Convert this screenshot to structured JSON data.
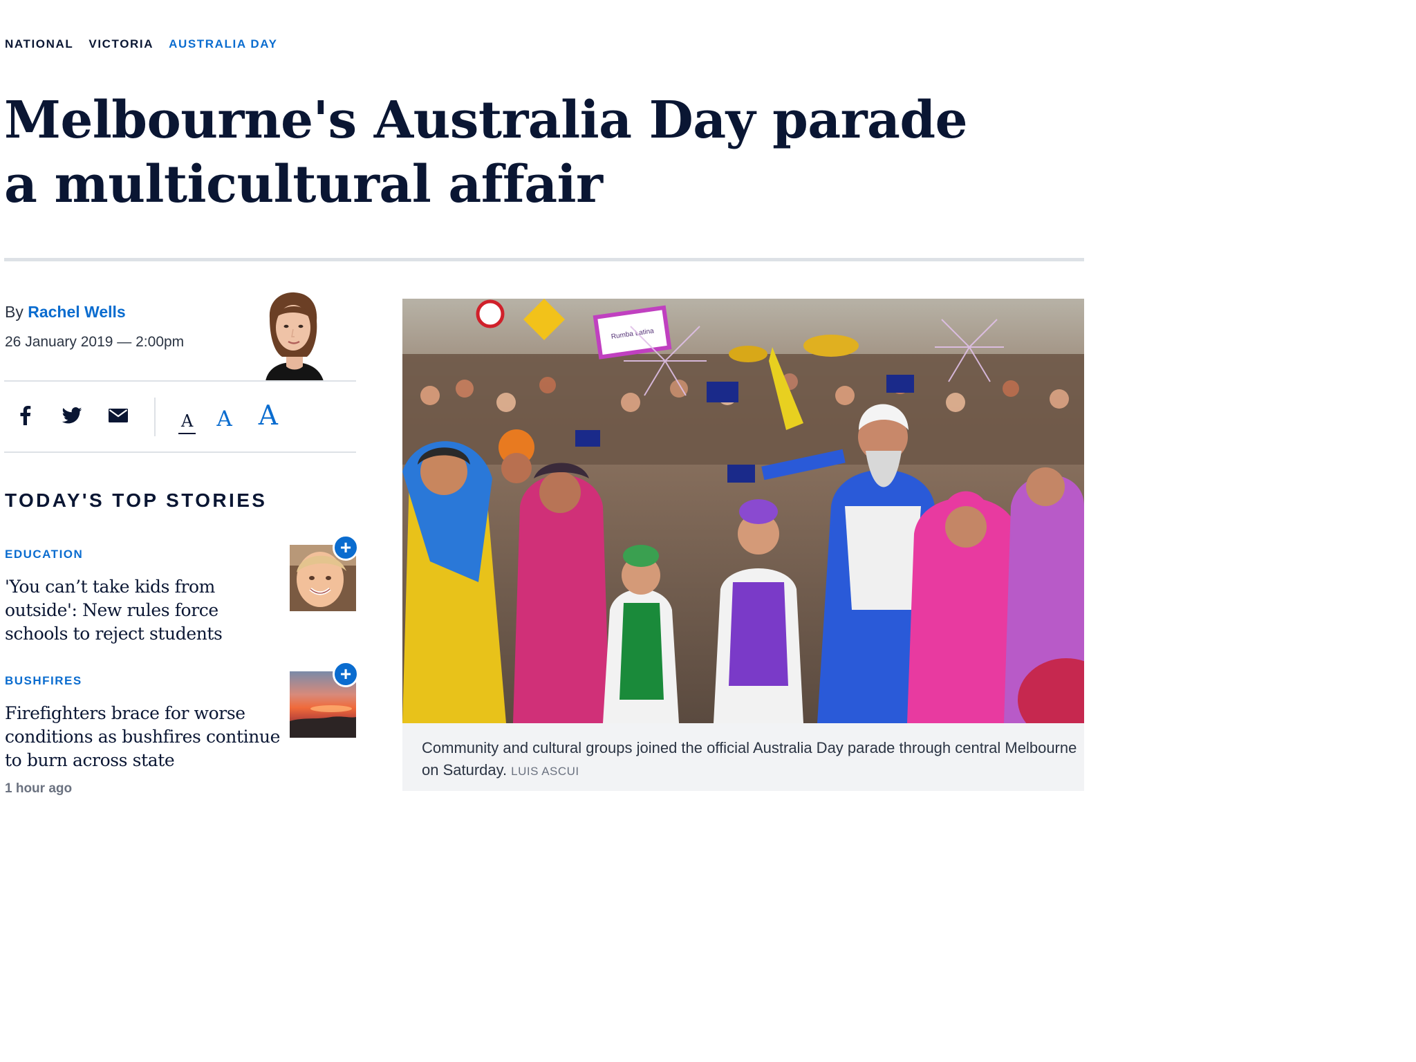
{
  "breadcrumb": [
    "NATIONAL",
    "VICTORIA",
    "AUSTRALIA DAY"
  ],
  "headline": "Melbourne's Australia Day parade a multicultural affair",
  "byline": {
    "prefix": "By",
    "author": "Rachel Wells"
  },
  "dateline": "26 January 2019 — 2:00pm",
  "share": {
    "icons": [
      "facebook-icon",
      "twitter-icon",
      "email-icon"
    ]
  },
  "font_sizes": [
    "A",
    "A",
    "A"
  ],
  "top_stories": {
    "heading": "TODAY'S TOP STORIES",
    "items": [
      {
        "category": "EDUCATION",
        "title": "'You can’t take kids from outside': New rules force schools to reject students"
      },
      {
        "category": "BUSHFIRES",
        "title": "Firefighters brace for worse conditions as bushfires continue to burn across state",
        "time": "1 hour ago"
      }
    ]
  },
  "hero": {
    "sign_text": "Rumba Latina",
    "caption": "Community and cultural groups joined the official Australia Day parade through central Melbourne on Saturday.",
    "credit": "LUIS ASCUI"
  },
  "colors": {
    "accent": "#0a6ccf",
    "ink": "#0a1633",
    "rule": "#dde1e6"
  }
}
